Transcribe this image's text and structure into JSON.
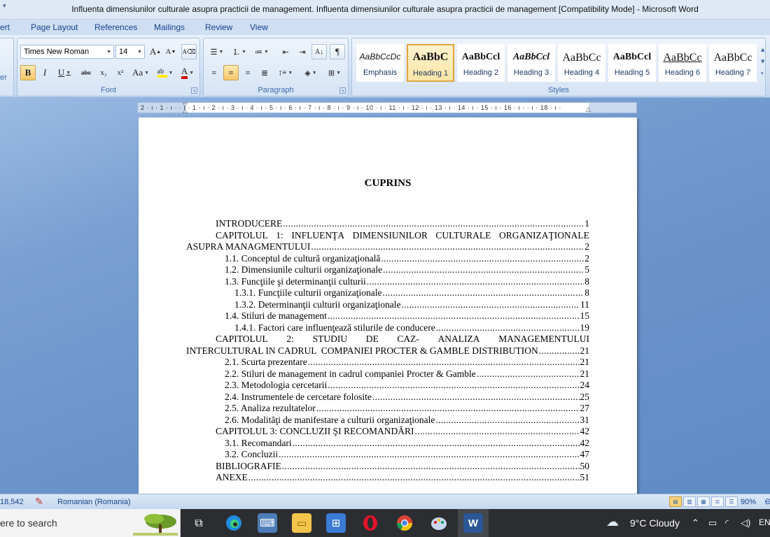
{
  "window": {
    "title": "Influenta dimensiunilor culturale asupra practicii de management. Influenta dimensiunilor culturale asupra practicii de management [Compatibility Mode] - Microsoft Word"
  },
  "ribbon_tabs": [
    "ert",
    "Page Layout",
    "References",
    "Mailings",
    "Review",
    "View"
  ],
  "font_group": {
    "font_name": "Times New Roman",
    "font_size": "14",
    "label": "Font",
    "grow_label": "A",
    "shrink_label": "A",
    "bold": "B",
    "italic": "I",
    "underline": "U",
    "strike": "abc",
    "subscript": "x₂",
    "superscript": "x²",
    "change_case": "Aa",
    "color_label": "A"
  },
  "paragraph_group": {
    "label": "Paragraph",
    "pilcrow": "¶"
  },
  "styles_group": {
    "label": "Styles",
    "tiles": [
      {
        "sample": "AaBbCcDc",
        "name": "Emphasis"
      },
      {
        "sample": "AaBbC",
        "name": "Heading 1"
      },
      {
        "sample": "AaBbCcl",
        "name": "Heading 2"
      },
      {
        "sample": "AaBbCcl",
        "name": "Heading 3"
      },
      {
        "sample": "AaBbCc",
        "name": "Heading 4"
      },
      {
        "sample": "AaBbCcl",
        "name": "Heading 5"
      },
      {
        "sample": "AaBbCc",
        "name": "Heading 6"
      },
      {
        "sample": "AaBbCc",
        "name": "Heading 7"
      }
    ]
  },
  "left_edge_label": "ter",
  "ruler": {
    "marks": "2 · ı · 1 · ı ·   · ı · 1 · ı · 2 · ı · 3 · ı · 4 · ı · 5 · ı · 6 · ı · 7 · ı · 8 · ı · 9 · ı · 10 · ı · 11 · ı · 12 · ı · 13 · ı · 14 · ı · 15 · ı · 16 · ı ·   · ı · 18 · ı ·"
  },
  "document": {
    "toc_title": "CUPRINS",
    "toc": {
      "intro": {
        "text": "INTRODUCERE",
        "page": "1"
      },
      "ch1_a": [
        "CAPITOLUL",
        "1:",
        "INFLUENŢA",
        "DIMENSIUNILOR",
        "CULTURALE",
        "ORGANIZAŢIONALE"
      ],
      "ch1_b": {
        "text": "ASUPRA MANAGMENTULUI",
        "page": "2"
      },
      "s11": {
        "text": "1.1. Conceptul de cultură organizaţională",
        "page": "2"
      },
      "s12": {
        "text": "1.2. Dimensiunile culturii organizaţionale",
        "page": "5"
      },
      "s13": {
        "text": "1.3. Funcţiile şi determinanţii culturii",
        "page": "8"
      },
      "s131": {
        "text": "1.3.1. Funcţiile culturii organizaţionale",
        "page": "8"
      },
      "s132": {
        "text": "1.3.2. Determinanţii culturii organizaţionale",
        "page": "11"
      },
      "s14": {
        "text": "1.4. Stiluri de management",
        "page": "15"
      },
      "s141": {
        "text": "1.4.1. Factori care influenţează stilurile de conducere",
        "page": "19"
      },
      "ch2_a": [
        "CAPITOLUL",
        "2:",
        "STUDIU",
        "DE",
        "CAZ-",
        "ANALIZA",
        "MANAGEMENTULUI"
      ],
      "ch2_b": {
        "text": "INTERCULTURAL IN CADRUL  COMPANIEI PROCTER & GAMBLE DISTRIBUTION",
        "page": "21"
      },
      "s21": {
        "text": "2.1. Scurta prezentare",
        "page": "21"
      },
      "s22": {
        "text": "2.2. Stiluri de management in cadrul companiei Procter & Gamble",
        "page": "21"
      },
      "s23": {
        "text": "2.3. Metodologia cercetarii",
        "page": "24"
      },
      "s24": {
        "text": "2.4. Instrumentele de cercetare folosite",
        "page": "25"
      },
      "s25": {
        "text": "2.5. Analiza rezultatelor",
        "page": "27"
      },
      "s26": {
        "text": "2.6. Modalităţi de manifestare a culturii organizaţionale",
        "page": "31"
      },
      "ch3": {
        "text": "CAPITOLUL 3: CONCLUZII ŞI RECOMANDĂRI",
        "page": "42"
      },
      "s31": {
        "text": "3.1. Recomandari",
        "page": "42"
      },
      "s32": {
        "text": "3.2. Concluzii",
        "page": "47"
      },
      "bib": {
        "text": "BIBLIOGRAFIE",
        "page": "50"
      },
      "anexe": {
        "text": "ANEXE",
        "page": "51"
      }
    }
  },
  "statusbar": {
    "words": "18,542",
    "language": "Romanian (Romania)",
    "zoom": "90%"
  },
  "taskbar": {
    "search_placeholder": "ere to search",
    "weather": "9°C  Cloudy",
    "lang": "EN",
    "icons": [
      "task-view",
      "edge",
      "computer",
      "file-explorer",
      "store",
      "opera",
      "chrome",
      "paint",
      "word"
    ]
  },
  "colors": {
    "accent": "#15428b",
    "ribbon": "#dfe9f5",
    "workspace": "#6d95c8",
    "taskbar": "#2b2d30"
  }
}
